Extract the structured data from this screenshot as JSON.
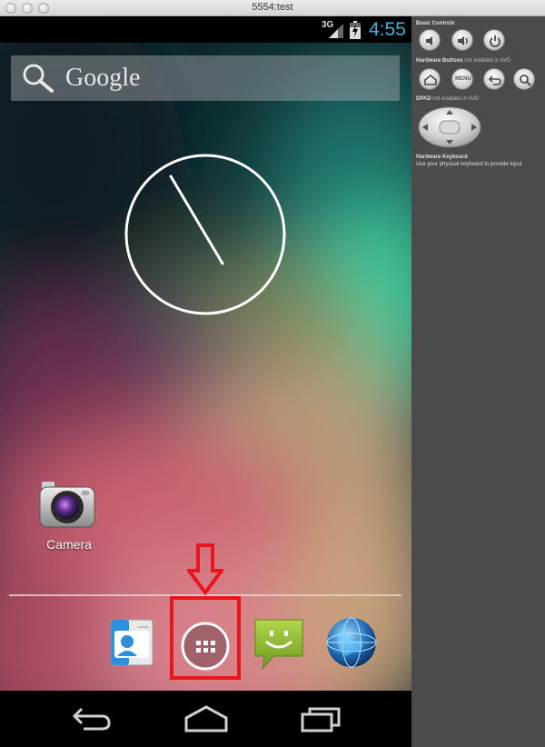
{
  "window": {
    "title": "5554:test"
  },
  "statusbar": {
    "network": "3G",
    "time": "4:55"
  },
  "search": {
    "label": "Google"
  },
  "desktop": {
    "camera_label": "Camera"
  },
  "dock": {
    "apps": [
      "contacts-icon",
      "all-apps-icon",
      "messaging-icon",
      "browser-icon"
    ]
  },
  "panel": {
    "basic_controls": "Basic Controls",
    "hardware_buttons": "Hardware Buttons",
    "hardware_buttons_note": "not enabled in AVD",
    "dpad": "DPAD",
    "dpad_note": "not enabled in AVD",
    "hardware_keyboard": "Hardware Keyboard",
    "keyboard_hint": "Use your physical keyboard to provide input",
    "menu_label": "MENU"
  },
  "colors": {
    "accent": "#33b5e5",
    "highlight": "#e8161c",
    "panel": "#4b4b4b"
  }
}
